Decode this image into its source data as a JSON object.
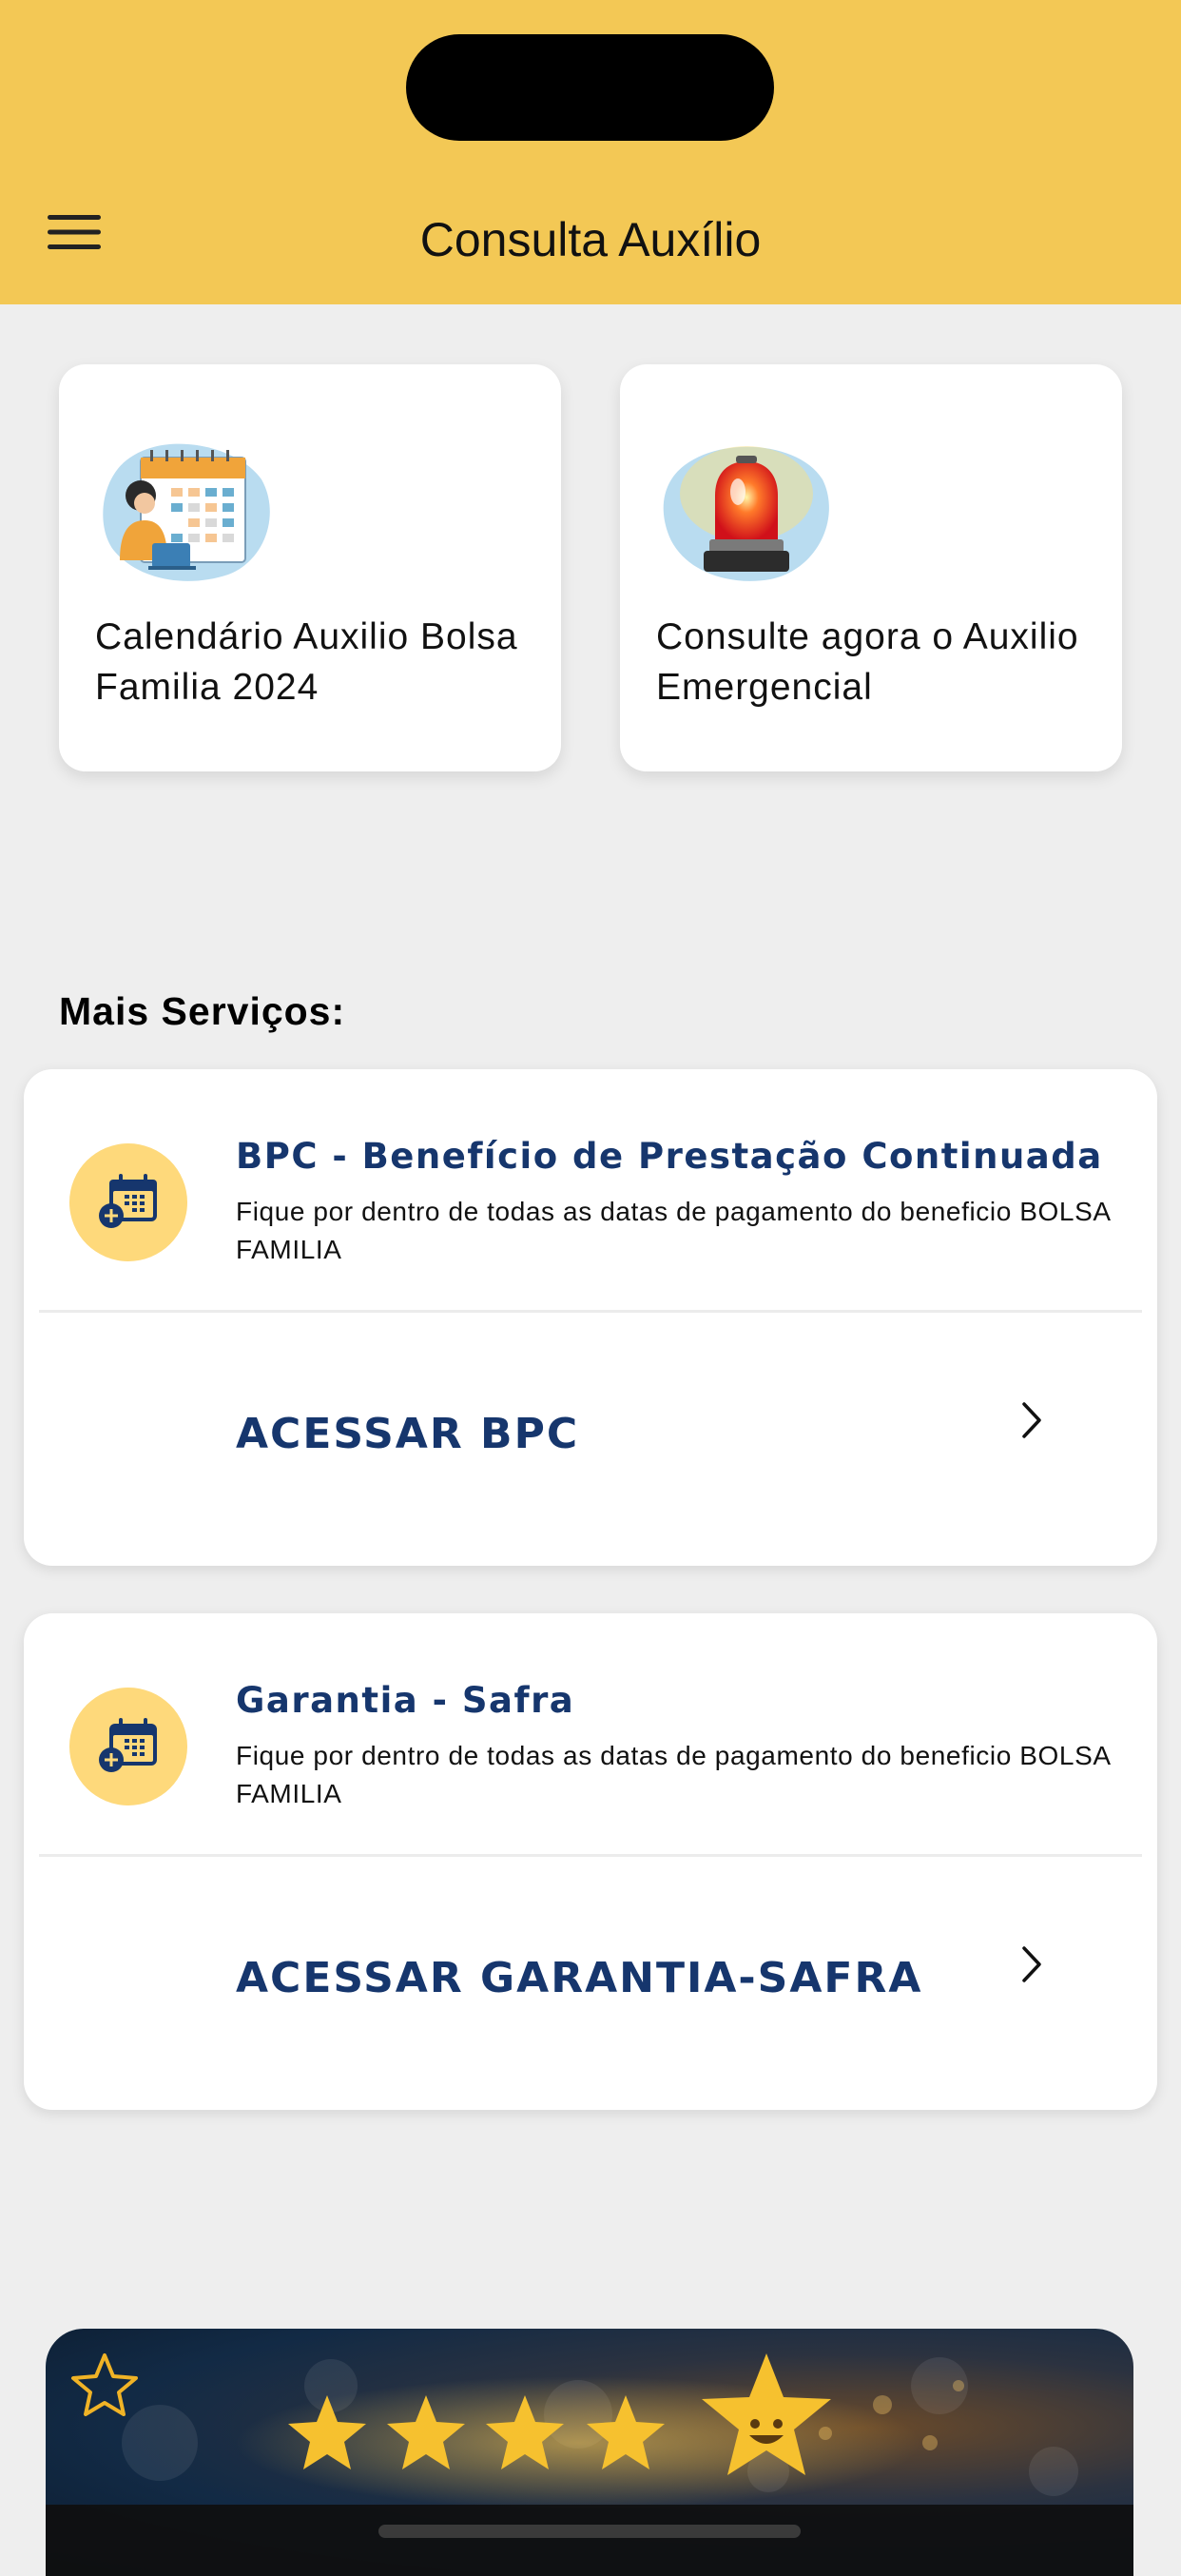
{
  "header": {
    "title": "Consulta Auxílio",
    "menu_icon": "hamburger-menu-icon",
    "background_color": "#f3c855"
  },
  "top_cards": [
    {
      "label": "Calendário Auxilio Bolsa Familia 2024",
      "icon": "calendar-person-illustration"
    },
    {
      "label": "Consulte agora o Auxilio Emergencial",
      "icon": "siren-illustration"
    }
  ],
  "section": {
    "title": "Mais Serviços:"
  },
  "services": [
    {
      "title": "BPC - Benefício de Prestação Continuada",
      "description": "Fique por dentro de todas as datas de pagamento do beneficio BOLSA FAMILIA",
      "action_label": "ACESSAR BPC",
      "icon": "calendar-add-icon"
    },
    {
      "title": "Garantia - Safra",
      "description": "Fique por dentro de todas as datas de pagamento do beneficio BOLSA FAMILIA",
      "action_label": "ACESSAR GARANTIA-SAFRA",
      "icon": "calendar-add-icon"
    }
  ],
  "banner": {
    "icon": "star-rating-icon",
    "stars": 5
  },
  "colors": {
    "accent": "#f3c855",
    "title_blue": "#16366d",
    "icon_circle": "#fed97b"
  }
}
